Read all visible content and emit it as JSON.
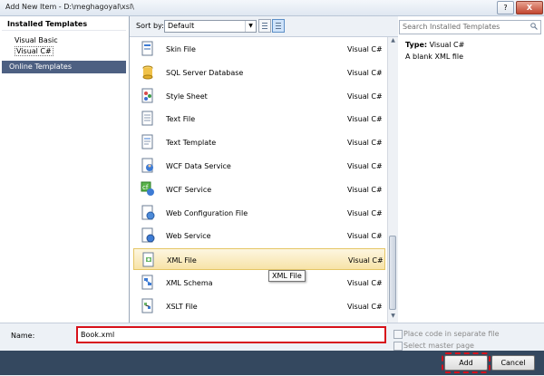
{
  "window": {
    "title": "Add New Item - D:\\meghagoyal\\xsl\\",
    "help_glyph": "?",
    "close_glyph": "X"
  },
  "left_pane": {
    "installed_header": "Installed Templates",
    "items": [
      "Visual Basic",
      "Visual C#"
    ],
    "selected_item": "Visual C#",
    "online_templates": "Online Templates"
  },
  "sort_bar": {
    "label": "Sort by:",
    "selected": "Default"
  },
  "search": {
    "placeholder": "Search Installed Templates"
  },
  "templates": [
    {
      "name": "Skin File",
      "type": "Visual C#",
      "icon": "skin-file-icon"
    },
    {
      "name": "SQL Server Database",
      "type": "Visual C#",
      "icon": "database-icon"
    },
    {
      "name": "Style Sheet",
      "type": "Visual C#",
      "icon": "style-sheet-icon"
    },
    {
      "name": "Text File",
      "type": "Visual C#",
      "icon": "text-file-icon"
    },
    {
      "name": "Text Template",
      "type": "Visual C#",
      "icon": "text-template-icon"
    },
    {
      "name": "WCF Data Service",
      "type": "Visual C#",
      "icon": "wcf-data-service-icon"
    },
    {
      "name": "WCF Service",
      "type": "Visual C#",
      "icon": "wcf-service-icon"
    },
    {
      "name": "Web Configuration File",
      "type": "Visual C#",
      "icon": "web-config-icon"
    },
    {
      "name": "Web Service",
      "type": "Visual C#",
      "icon": "web-service-icon"
    },
    {
      "name": "XML File",
      "type": "Visual C#",
      "icon": "xml-file-icon"
    },
    {
      "name": "XML Schema",
      "type": "Visual C#",
      "icon": "xml-schema-icon"
    },
    {
      "name": "XSLT File",
      "type": "Visual C#",
      "icon": "xslt-file-icon"
    }
  ],
  "selected_template": "XML File",
  "tooltip": "XML File",
  "details": {
    "type_label": "Type:",
    "type_value": "Visual C#",
    "description": "A blank XML file"
  },
  "bottom": {
    "name_label": "Name:",
    "name_value": "Book.xml",
    "place_code_label": "Place code in separate file",
    "select_master_label": "Select master page"
  },
  "buttons": {
    "add": "Add",
    "cancel": "Cancel"
  },
  "colors": {
    "highlight_box": "#d7111b",
    "selected_row": "#f7e3a8",
    "online_bar": "#4d6082",
    "footer": "#34485f"
  }
}
